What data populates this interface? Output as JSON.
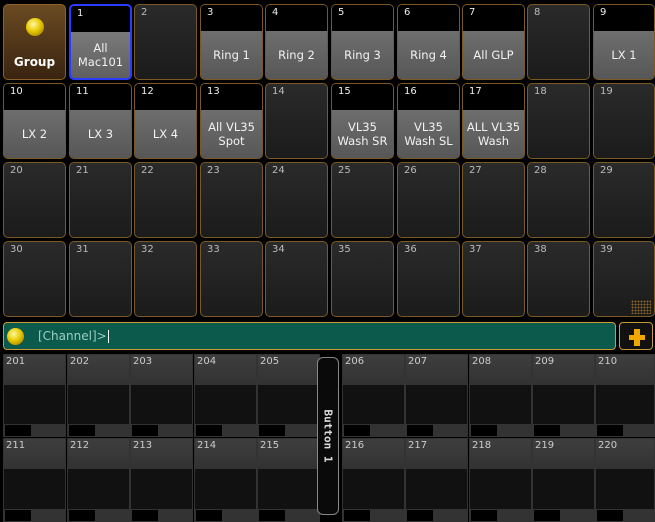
{
  "pool": {
    "group_label": "Group",
    "cells": [
      {
        "num": "1",
        "label": "All Mac101",
        "selected": true
      },
      {
        "num": "2",
        "label": ""
      },
      {
        "num": "3",
        "label": "Ring 1"
      },
      {
        "num": "4",
        "label": "Ring 2"
      },
      {
        "num": "5",
        "label": "Ring 3"
      },
      {
        "num": "6",
        "label": "Ring 4"
      },
      {
        "num": "7",
        "label": "All GLP"
      },
      {
        "num": "8",
        "label": ""
      },
      {
        "num": "9",
        "label": "LX 1"
      },
      {
        "num": "10",
        "label": "LX 2"
      },
      {
        "num": "11",
        "label": "LX 3"
      },
      {
        "num": "12",
        "label": "LX 4"
      },
      {
        "num": "13",
        "label": "All VL35\nSpot"
      },
      {
        "num": "14",
        "label": ""
      },
      {
        "num": "15",
        "label": "VL35\nWash SR"
      },
      {
        "num": "16",
        "label": "VL35\nWash SL"
      },
      {
        "num": "17",
        "label": "ALL VL35\nWash"
      },
      {
        "num": "18",
        "label": ""
      },
      {
        "num": "19",
        "label": ""
      },
      {
        "num": "20",
        "label": ""
      },
      {
        "num": "21",
        "label": ""
      },
      {
        "num": "22",
        "label": ""
      },
      {
        "num": "23",
        "label": ""
      },
      {
        "num": "24",
        "label": ""
      },
      {
        "num": "25",
        "label": ""
      },
      {
        "num": "26",
        "label": ""
      },
      {
        "num": "27",
        "label": ""
      },
      {
        "num": "28",
        "label": ""
      },
      {
        "num": "29",
        "label": ""
      },
      {
        "num": "30",
        "label": ""
      },
      {
        "num": "31",
        "label": ""
      },
      {
        "num": "32",
        "label": ""
      },
      {
        "num": "33",
        "label": ""
      },
      {
        "num": "34",
        "label": ""
      },
      {
        "num": "35",
        "label": ""
      },
      {
        "num": "36",
        "label": ""
      },
      {
        "num": "37",
        "label": ""
      },
      {
        "num": "38",
        "label": ""
      },
      {
        "num": "39",
        "label": ""
      }
    ]
  },
  "command_line": {
    "prompt": "[Channel]>"
  },
  "executors": {
    "row1": [
      "201",
      "202",
      "203",
      "204",
      "205",
      "206",
      "207",
      "208",
      "209",
      "210"
    ],
    "row2": [
      "211",
      "212",
      "213",
      "214",
      "215",
      "216",
      "217",
      "218",
      "219",
      "220"
    ],
    "button_label": "Button 1"
  }
}
